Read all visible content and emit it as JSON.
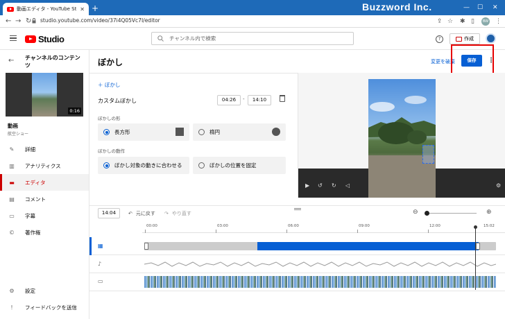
{
  "browser": {
    "tab_title": "動画エディタ - YouTube Studio",
    "tab_close": "✕",
    "new_tab": "+",
    "url": "studio.youtube.com/video/37i4Q05Vc7I/editor",
    "brand": "Buzzword Inc.",
    "profile_initials": "BW"
  },
  "header": {
    "logo_text": "Studio",
    "search_placeholder": "チャンネル内で検索",
    "help_label": "?",
    "create_label": "作成"
  },
  "sidebar": {
    "title": "チャンネルのコンテンツ",
    "duration": "0:16",
    "video_label": "動画",
    "video_sub": "航空ショー",
    "items": [
      {
        "label": "詳細",
        "icon": "pencil-icon",
        "glyph": "✎"
      },
      {
        "label": "アナリティクス",
        "icon": "analytics-icon",
        "glyph": "▥"
      },
      {
        "label": "エディタ",
        "icon": "editor-icon",
        "glyph": "▬"
      },
      {
        "label": "コメント",
        "icon": "comment-icon",
        "glyph": "▤"
      },
      {
        "label": "字幕",
        "icon": "subtitles-icon",
        "glyph": "▭"
      },
      {
        "label": "著作権",
        "icon": "copyright-icon",
        "glyph": "©"
      }
    ],
    "settings_label": "設定",
    "feedback_label": "フィードバックを送信"
  },
  "editor": {
    "title": "ぼかし",
    "undo_changes": "変更を破棄",
    "save_label": "保存",
    "add_blur": "＋  ぼかし",
    "blur_name": "カスタムぼかし",
    "start_time": "04:26",
    "end_time": "14:10",
    "time_separator": "-",
    "shape_label": "ぼかしの形",
    "shape_options": [
      "長方形",
      "楕円"
    ],
    "selected_shape": "長方形",
    "motion_label": "ぼかしの動作",
    "motion_options": [
      "ぼかし対象の動きに合わせる",
      "ぼかしの位置を固定"
    ],
    "selected_motion": "ぼかし対象の動きに合わせる"
  },
  "timeline": {
    "current_time": "14:04",
    "undo_label": "元に戻す",
    "redo_label": "やり直す",
    "ticks": [
      "00:00",
      "03:00",
      "06:00",
      "09:00",
      "12:00",
      "15:02"
    ]
  }
}
